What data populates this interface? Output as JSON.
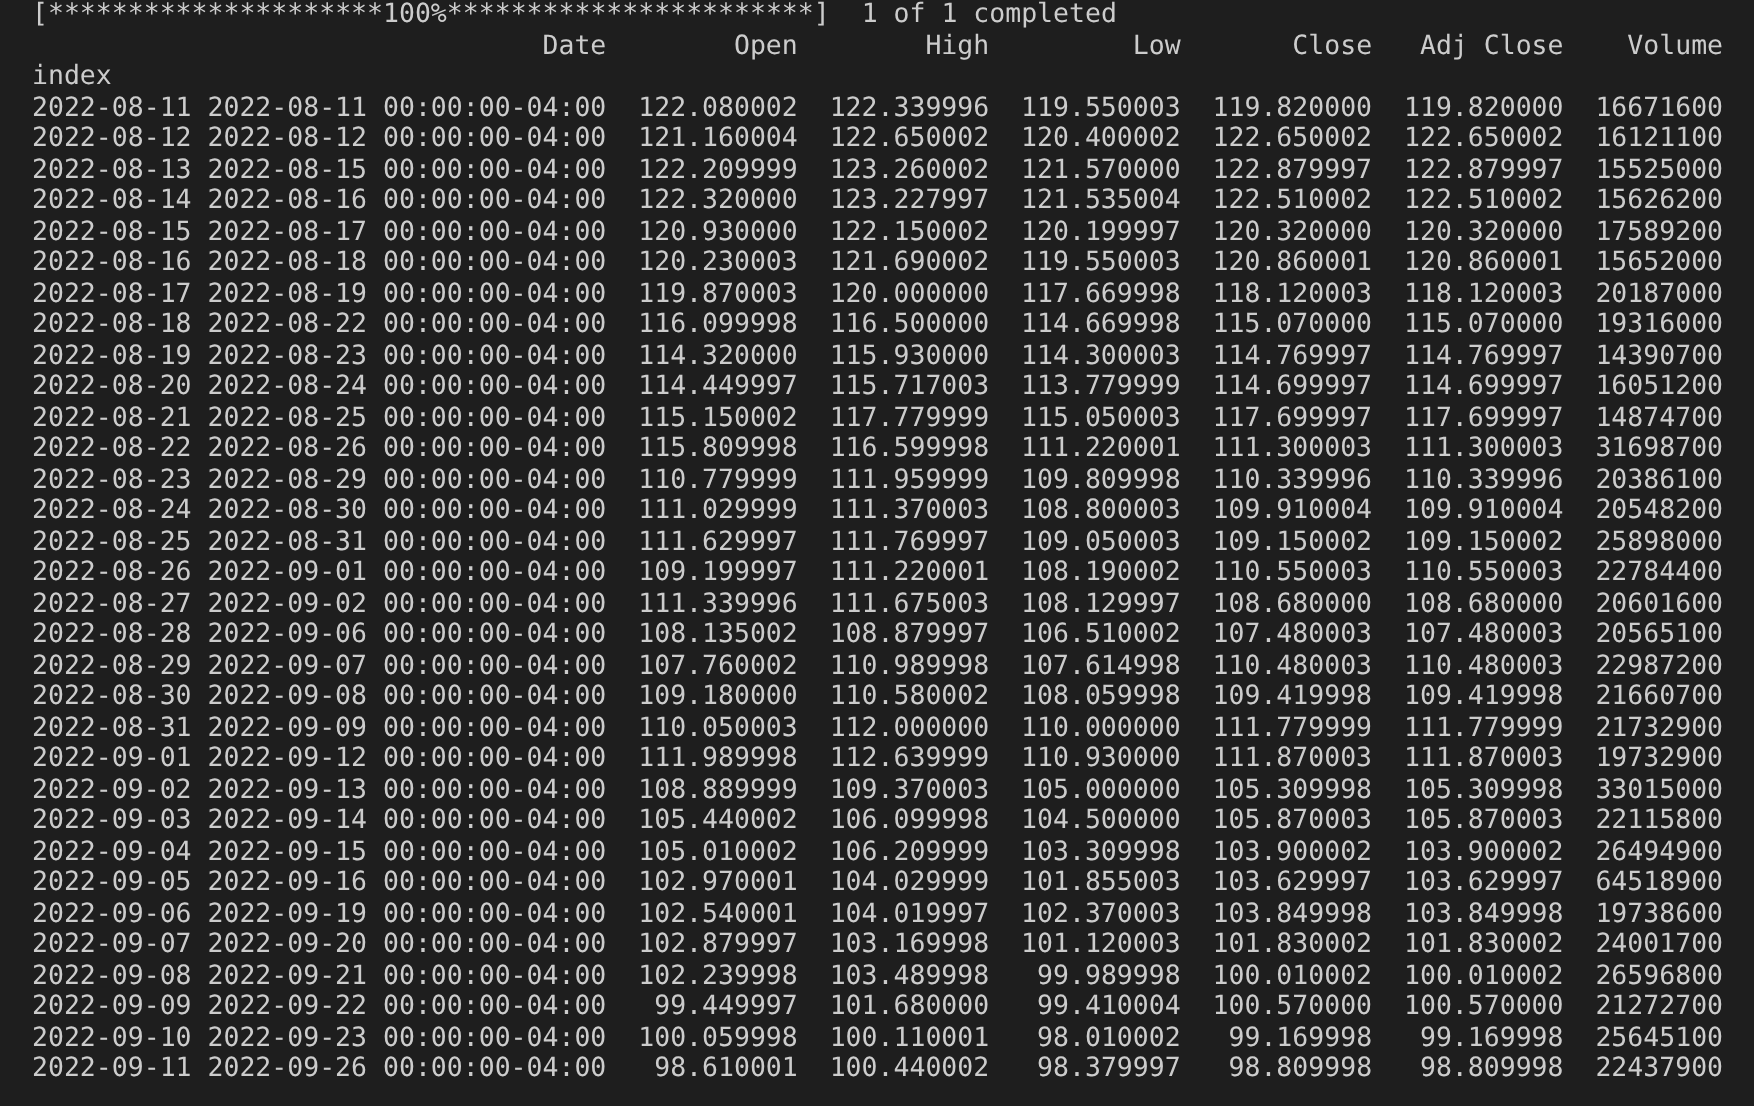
{
  "progress_line": "[*********************100%***********************]  1 of 1 completed",
  "table": {
    "index_label": "index",
    "columns": [
      "Date",
      "Open",
      "High",
      "Low",
      "Close",
      "Adj Close",
      "Volume"
    ],
    "rows": [
      {
        "index": "2022-08-11",
        "cells": [
          "2022-08-11 00:00:00-04:00",
          "122.080002",
          "122.339996",
          "119.550003",
          "119.820000",
          "119.820000",
          "16671600"
        ]
      },
      {
        "index": "2022-08-12",
        "cells": [
          "2022-08-12 00:00:00-04:00",
          "121.160004",
          "122.650002",
          "120.400002",
          "122.650002",
          "122.650002",
          "16121100"
        ]
      },
      {
        "index": "2022-08-13",
        "cells": [
          "2022-08-15 00:00:00-04:00",
          "122.209999",
          "123.260002",
          "121.570000",
          "122.879997",
          "122.879997",
          "15525000"
        ]
      },
      {
        "index": "2022-08-14",
        "cells": [
          "2022-08-16 00:00:00-04:00",
          "122.320000",
          "123.227997",
          "121.535004",
          "122.510002",
          "122.510002",
          "15626200"
        ]
      },
      {
        "index": "2022-08-15",
        "cells": [
          "2022-08-17 00:00:00-04:00",
          "120.930000",
          "122.150002",
          "120.199997",
          "120.320000",
          "120.320000",
          "17589200"
        ]
      },
      {
        "index": "2022-08-16",
        "cells": [
          "2022-08-18 00:00:00-04:00",
          "120.230003",
          "121.690002",
          "119.550003",
          "120.860001",
          "120.860001",
          "15652000"
        ]
      },
      {
        "index": "2022-08-17",
        "cells": [
          "2022-08-19 00:00:00-04:00",
          "119.870003",
          "120.000000",
          "117.669998",
          "118.120003",
          "118.120003",
          "20187000"
        ]
      },
      {
        "index": "2022-08-18",
        "cells": [
          "2022-08-22 00:00:00-04:00",
          "116.099998",
          "116.500000",
          "114.669998",
          "115.070000",
          "115.070000",
          "19316000"
        ]
      },
      {
        "index": "2022-08-19",
        "cells": [
          "2022-08-23 00:00:00-04:00",
          "114.320000",
          "115.930000",
          "114.300003",
          "114.769997",
          "114.769997",
          "14390700"
        ]
      },
      {
        "index": "2022-08-20",
        "cells": [
          "2022-08-24 00:00:00-04:00",
          "114.449997",
          "115.717003",
          "113.779999",
          "114.699997",
          "114.699997",
          "16051200"
        ]
      },
      {
        "index": "2022-08-21",
        "cells": [
          "2022-08-25 00:00:00-04:00",
          "115.150002",
          "117.779999",
          "115.050003",
          "117.699997",
          "117.699997",
          "14874700"
        ]
      },
      {
        "index": "2022-08-22",
        "cells": [
          "2022-08-26 00:00:00-04:00",
          "115.809998",
          "116.599998",
          "111.220001",
          "111.300003",
          "111.300003",
          "31698700"
        ]
      },
      {
        "index": "2022-08-23",
        "cells": [
          "2022-08-29 00:00:00-04:00",
          "110.779999",
          "111.959999",
          "109.809998",
          "110.339996",
          "110.339996",
          "20386100"
        ]
      },
      {
        "index": "2022-08-24",
        "cells": [
          "2022-08-30 00:00:00-04:00",
          "111.029999",
          "111.370003",
          "108.800003",
          "109.910004",
          "109.910004",
          "20548200"
        ]
      },
      {
        "index": "2022-08-25",
        "cells": [
          "2022-08-31 00:00:00-04:00",
          "111.629997",
          "111.769997",
          "109.050003",
          "109.150002",
          "109.150002",
          "25898000"
        ]
      },
      {
        "index": "2022-08-26",
        "cells": [
          "2022-09-01 00:00:00-04:00",
          "109.199997",
          "111.220001",
          "108.190002",
          "110.550003",
          "110.550003",
          "22784400"
        ]
      },
      {
        "index": "2022-08-27",
        "cells": [
          "2022-09-02 00:00:00-04:00",
          "111.339996",
          "111.675003",
          "108.129997",
          "108.680000",
          "108.680000",
          "20601600"
        ]
      },
      {
        "index": "2022-08-28",
        "cells": [
          "2022-09-06 00:00:00-04:00",
          "108.135002",
          "108.879997",
          "106.510002",
          "107.480003",
          "107.480003",
          "20565100"
        ]
      },
      {
        "index": "2022-08-29",
        "cells": [
          "2022-09-07 00:00:00-04:00",
          "107.760002",
          "110.989998",
          "107.614998",
          "110.480003",
          "110.480003",
          "22987200"
        ]
      },
      {
        "index": "2022-08-30",
        "cells": [
          "2022-09-08 00:00:00-04:00",
          "109.180000",
          "110.580002",
          "108.059998",
          "109.419998",
          "109.419998",
          "21660700"
        ]
      },
      {
        "index": "2022-08-31",
        "cells": [
          "2022-09-09 00:00:00-04:00",
          "110.050003",
          "112.000000",
          "110.000000",
          "111.779999",
          "111.779999",
          "21732900"
        ]
      },
      {
        "index": "2022-09-01",
        "cells": [
          "2022-09-12 00:00:00-04:00",
          "111.989998",
          "112.639999",
          "110.930000",
          "111.870003",
          "111.870003",
          "19732900"
        ]
      },
      {
        "index": "2022-09-02",
        "cells": [
          "2022-09-13 00:00:00-04:00",
          "108.889999",
          "109.370003",
          "105.000000",
          "105.309998",
          "105.309998",
          "33015000"
        ]
      },
      {
        "index": "2022-09-03",
        "cells": [
          "2022-09-14 00:00:00-04:00",
          "105.440002",
          "106.099998",
          "104.500000",
          "105.870003",
          "105.870003",
          "22115800"
        ]
      },
      {
        "index": "2022-09-04",
        "cells": [
          "2022-09-15 00:00:00-04:00",
          "105.010002",
          "106.209999",
          "103.309998",
          "103.900002",
          "103.900002",
          "26494900"
        ]
      },
      {
        "index": "2022-09-05",
        "cells": [
          "2022-09-16 00:00:00-04:00",
          "102.970001",
          "104.029999",
          "101.855003",
          "103.629997",
          "103.629997",
          "64518900"
        ]
      },
      {
        "index": "2022-09-06",
        "cells": [
          "2022-09-19 00:00:00-04:00",
          "102.540001",
          "104.019997",
          "102.370003",
          "103.849998",
          "103.849998",
          "19738600"
        ]
      },
      {
        "index": "2022-09-07",
        "cells": [
          "2022-09-20 00:00:00-04:00",
          "102.879997",
          "103.169998",
          "101.120003",
          "101.830002",
          "101.830002",
          "24001700"
        ]
      },
      {
        "index": "2022-09-08",
        "cells": [
          "2022-09-21 00:00:00-04:00",
          "102.239998",
          "103.489998",
          "99.989998",
          "100.010002",
          "100.010002",
          "26596800"
        ]
      },
      {
        "index": "2022-09-09",
        "cells": [
          "2022-09-22 00:00:00-04:00",
          "99.449997",
          "101.680000",
          "99.410004",
          "100.570000",
          "100.570000",
          "21272700"
        ]
      },
      {
        "index": "2022-09-10",
        "cells": [
          "2022-09-23 00:00:00-04:00",
          "100.059998",
          "100.110001",
          "98.010002",
          "99.169998",
          "99.169998",
          "25645100"
        ]
      },
      {
        "index": "2022-09-11",
        "cells": [
          "2022-09-26 00:00:00-04:00",
          "98.610001",
          "100.440002",
          "98.379997",
          "98.809998",
          "98.809998",
          "22437900"
        ]
      }
    ]
  }
}
